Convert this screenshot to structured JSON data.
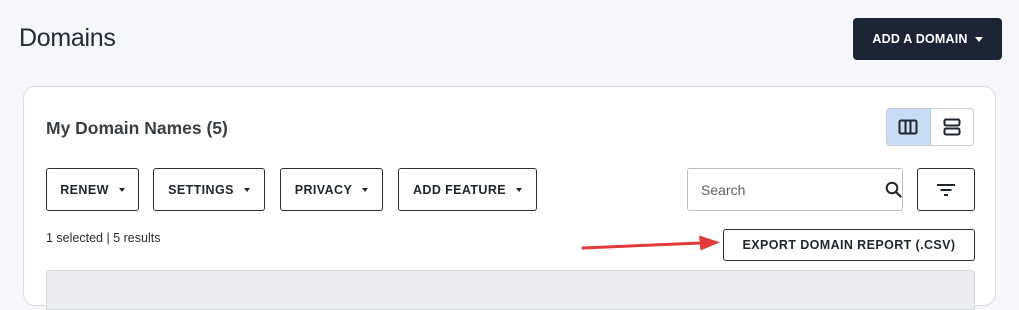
{
  "page": {
    "title": "Domains"
  },
  "header": {
    "add_domain_label": "ADD A DOMAIN"
  },
  "card": {
    "title": "My Domain Names (5)",
    "view_toggle": {
      "active": "columns",
      "options": [
        "columns-view-icon",
        "rows-view-icon"
      ]
    }
  },
  "toolbar": {
    "actions": [
      {
        "label": "RENEW"
      },
      {
        "label": "SETTINGS"
      },
      {
        "label": "PRIVACY"
      },
      {
        "label": "ADD FEATURE"
      }
    ],
    "search": {
      "placeholder": "Search",
      "value": ""
    }
  },
  "status": {
    "selected": "1 selected",
    "separator": "|",
    "results": "5 results"
  },
  "export": {
    "label": "EXPORT DOMAIN REPORT (.CSV)"
  },
  "colors": {
    "primary_button_bg": "#1b2535",
    "active_toggle_bg": "#c7dcf5",
    "annotation_arrow": "#e03a3a",
    "page_bg": "#f5f7fa"
  }
}
